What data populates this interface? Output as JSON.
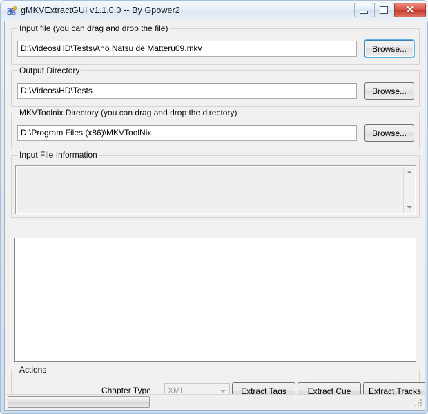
{
  "window": {
    "title": "gMKVExtractGUI v1.1.0.0 -- By Gpower2",
    "icon": "app-atom-icon",
    "controls": {
      "minimize": "Minimize",
      "maximize": "Maximize",
      "close": "Close",
      "close_glyph": "✕"
    }
  },
  "input_file_group": {
    "legend": "Input file (you can drag and drop the file)",
    "path_value": "D:\\Videos\\HD\\Tests\\Ano Natsu de Matteru09.mkv",
    "path_placeholder": "",
    "browse_label": "Browse..."
  },
  "output_dir_group": {
    "legend": "Output Directory",
    "path_value": "D:\\Videos\\HD\\Tests",
    "path_placeholder": "",
    "browse_label": "Browse..."
  },
  "mkvtoolnix_group": {
    "legend": "MKVToolnix Directory (you can drag and drop the directory)",
    "path_value": "D:\\Program Files (x86)\\MKVToolNix",
    "path_placeholder": "",
    "browse_label": "Browse..."
  },
  "file_info_group": {
    "legend": "Input File Information",
    "content": "",
    "scrollbar": {
      "up_icon": "scroll-up-arrow-icon",
      "down_icon": "scroll-down-arrow-icon"
    }
  },
  "tracks_list": {
    "content": ""
  },
  "actions_group": {
    "legend": "Actions",
    "chapter_type_label": "Chapter Type",
    "chapter_type_value": "XML",
    "chapter_type_options": [
      "XML"
    ],
    "extract_tags_label": "Extract Tags",
    "extract_cue_label": "Extract Cue",
    "extract_tracks_label": "Extract Tracks"
  },
  "statusbar": {
    "progress_text": "",
    "progress_percent": 0,
    "grip_icon": "resize-grip-icon"
  },
  "colors": {
    "form_background": "#f0f0f0",
    "accent_focus": "#3c7fb1",
    "close_button": "#c4392c",
    "titlebar": "#e7eef6"
  }
}
